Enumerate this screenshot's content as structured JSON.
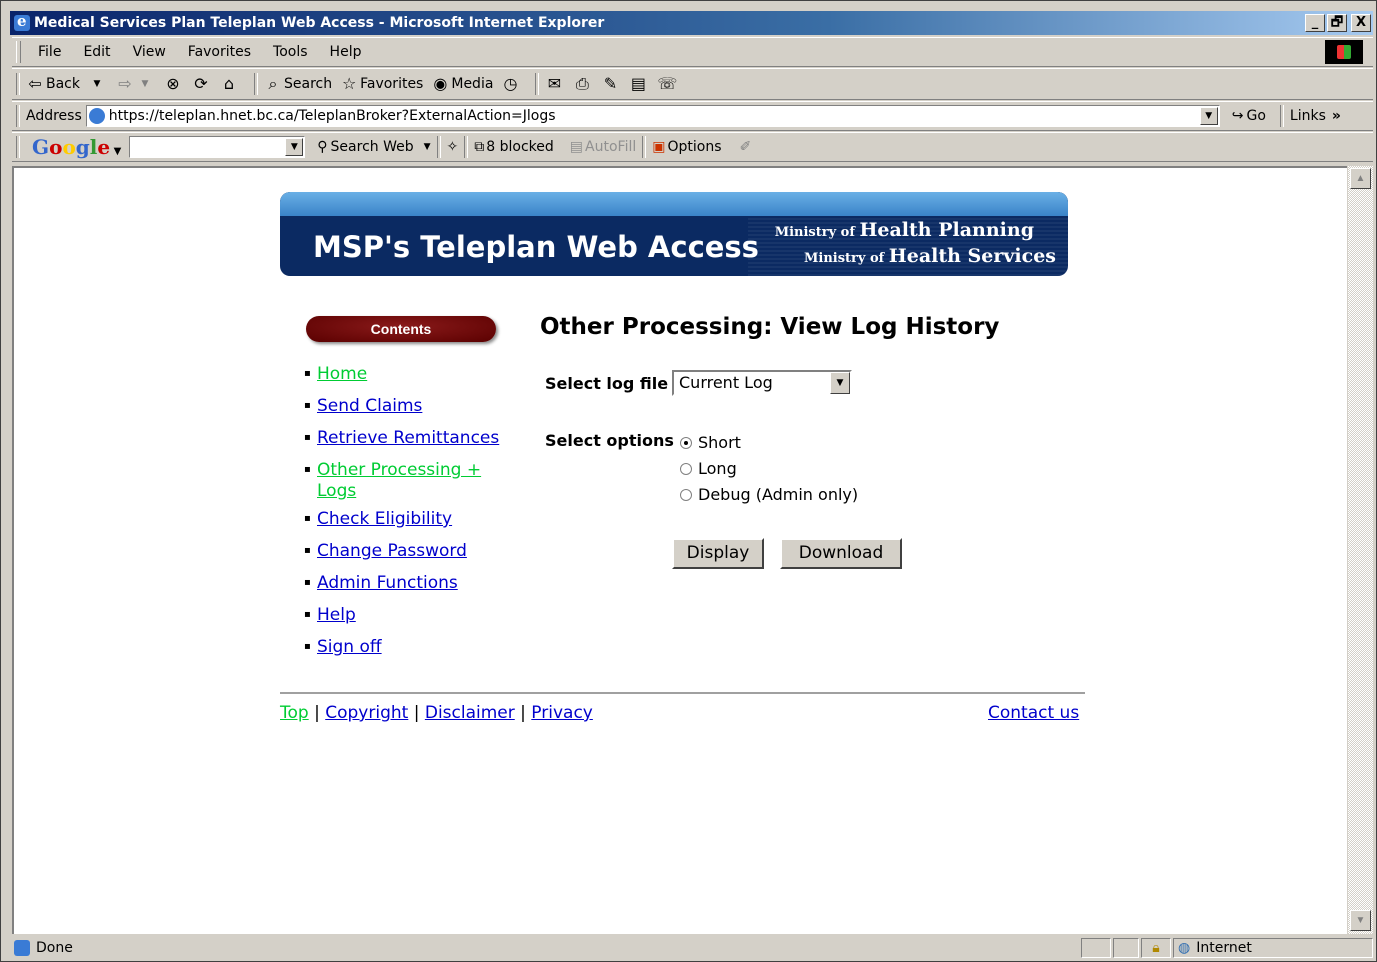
{
  "window": {
    "title": "Medical Services Plan Teleplan Web Access - Microsoft Internet Explorer",
    "controls": [
      "_",
      "🗗",
      "X"
    ]
  },
  "menubar": [
    "File",
    "Edit",
    "View",
    "Favorites",
    "Tools",
    "Help"
  ],
  "toolbar": {
    "back": "Back",
    "search": "Search",
    "favorites": "Favorites",
    "media": "Media"
  },
  "addressbar": {
    "label": "Address",
    "url": "https://teleplan.hnet.bc.ca/TeleplanBroker?ExternalAction=Jlogs",
    "go": "Go",
    "links": "Links",
    "more": "»"
  },
  "googlebar": {
    "logo": [
      "G",
      "o",
      "o",
      "g",
      "l",
      "e"
    ],
    "search_web": "Search Web",
    "blocked": "8 blocked",
    "autofill": "AutoFill",
    "options": "Options"
  },
  "banner": {
    "title": "MSP's Teleplan Web Access",
    "ministry1_small": "Ministry of",
    "ministry1_big": "Health Planning",
    "ministry2_small": "Ministry of",
    "ministry2_big": "Health Services"
  },
  "sidebar": {
    "heading": "Contents",
    "items": [
      {
        "label": "Home",
        "visited": true
      },
      {
        "label": "Send Claims",
        "visited": false
      },
      {
        "label": "Retrieve Remittances",
        "visited": false
      },
      {
        "label": "Other Processing +",
        "label2": "Logs",
        "visited": true
      },
      {
        "label": "Check Eligibility",
        "visited": false
      },
      {
        "label": "Change Password",
        "visited": false
      },
      {
        "label": "Admin Functions",
        "visited": false
      },
      {
        "label": "Help",
        "visited": false
      },
      {
        "label": "Sign off",
        "visited": false
      }
    ]
  },
  "main": {
    "heading": "Other Processing: View Log History",
    "select_log_label": "Select log file",
    "select_log_value": "Current Log",
    "select_options_label": "Select options",
    "options": [
      {
        "label": "Short",
        "checked": true
      },
      {
        "label": "Long",
        "checked": false
      },
      {
        "label": "Debug (Admin only)",
        "checked": false
      }
    ],
    "display_button": "Display",
    "download_button": "Download"
  },
  "footer": {
    "top": "Top",
    "copyright": "Copyright",
    "disclaimer": "Disclaimer",
    "privacy": "Privacy",
    "separator": "|",
    "contact": "Contact us"
  },
  "status": {
    "text": "Done",
    "zone": "Internet"
  }
}
